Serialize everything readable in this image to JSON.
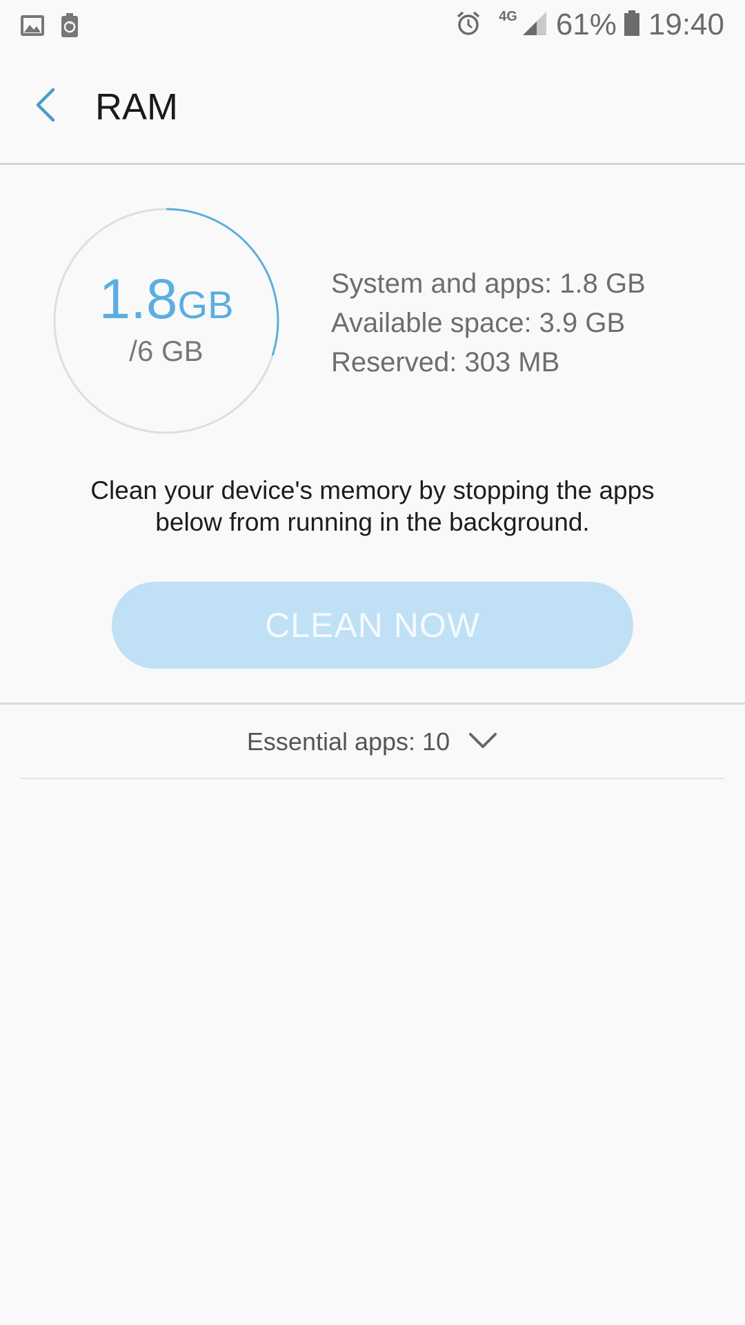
{
  "status_bar": {
    "left_icons": [
      "gallery-icon",
      "battery-saver-icon"
    ],
    "right_icons": [
      "alarm-icon",
      "signal-icon",
      "battery-icon"
    ],
    "network": "4G",
    "battery": "61%",
    "time": "19:40"
  },
  "header": {
    "title": "RAM",
    "back_icon": "chevron-left-icon"
  },
  "memory": {
    "used_value": "1.8",
    "used_unit": "GB",
    "total": "/6 GB",
    "used_fraction": 0.3,
    "ring_color": "#5aaee0",
    "details": {
      "system_and_apps": "System and apps: 1.8 GB",
      "available_space": "Available space: 3.9 GB",
      "reserved": "Reserved: 303 MB"
    }
  },
  "description": "Clean your device's memory by stopping the apps below from running in the background.",
  "clean_button": {
    "label": "CLEAN NOW",
    "color": "#bfe0f5"
  },
  "essential_apps": {
    "label": "Essential apps: 10",
    "icon": "chevron-down-icon"
  }
}
